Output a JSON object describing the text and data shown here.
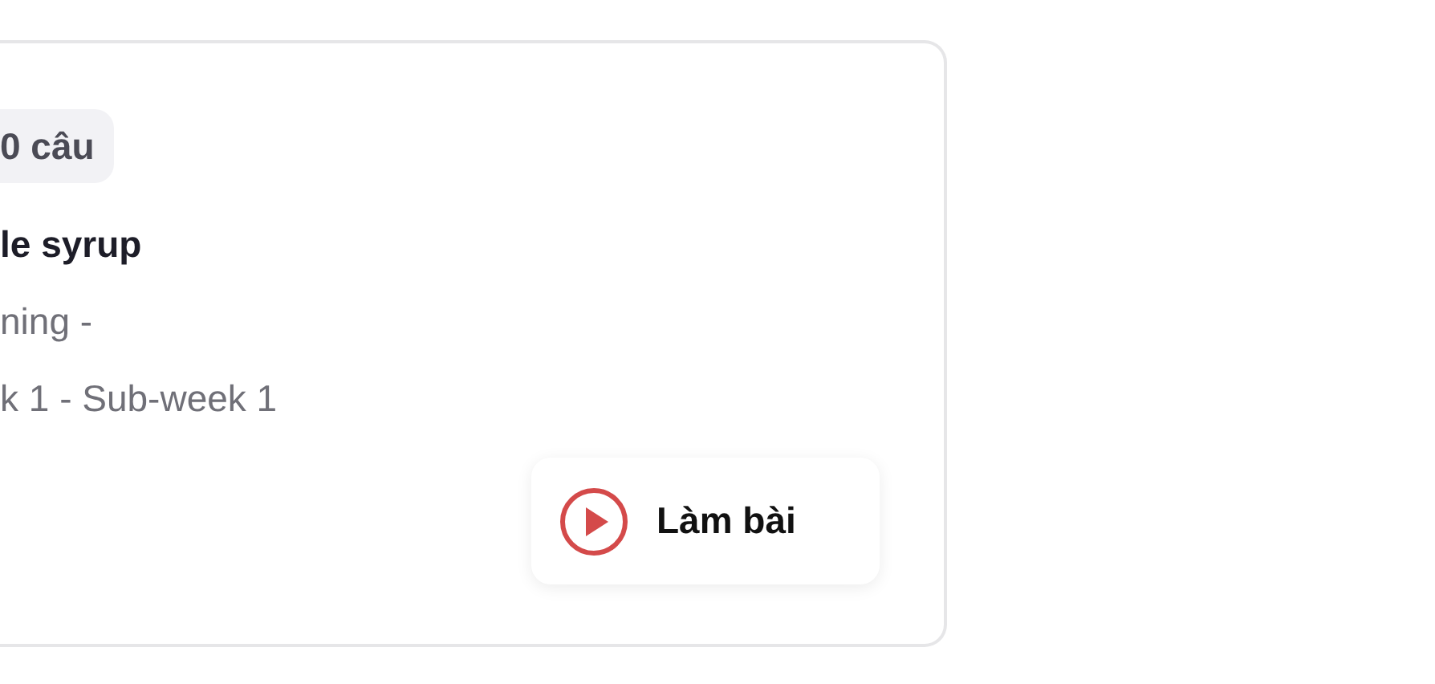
{
  "card": {
    "badge": "0 câu",
    "title": "le syrup",
    "lines": [
      "ning -",
      "k 1 - Sub-week 1"
    ],
    "button": "Làm bài"
  }
}
